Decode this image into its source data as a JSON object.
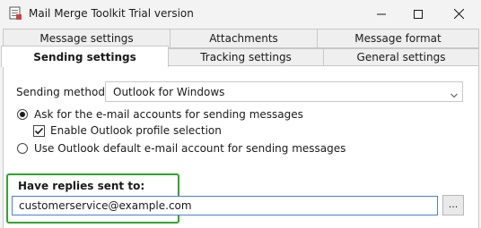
{
  "window": {
    "title": "Mail Merge Toolkit Trial version",
    "icons": [
      "app-icon",
      "minimize-icon",
      "maximize-icon",
      "close-icon"
    ]
  },
  "tabs": {
    "row1": [
      "Message settings",
      "Attachments",
      "Message format"
    ],
    "row2": [
      "Sending settings",
      "Tracking settings",
      "General settings"
    ],
    "active": "Sending settings"
  },
  "sending": {
    "method_label": "Sending method:",
    "method_value": "Outlook for Windows",
    "option_ask": "Ask for the e-mail accounts for sending messages",
    "option_ask_checked": true,
    "enable_profile": "Enable Outlook profile selection",
    "enable_profile_checked": true,
    "option_default": "Use Outlook default e-mail account for sending messages",
    "option_default_checked": false
  },
  "replies": {
    "label": "Have replies sent to:",
    "value": "customerservice@example.com",
    "browse_label": "..."
  },
  "colors": {
    "highlight": "#2fa52f",
    "input_border": "#4a7fd6"
  }
}
